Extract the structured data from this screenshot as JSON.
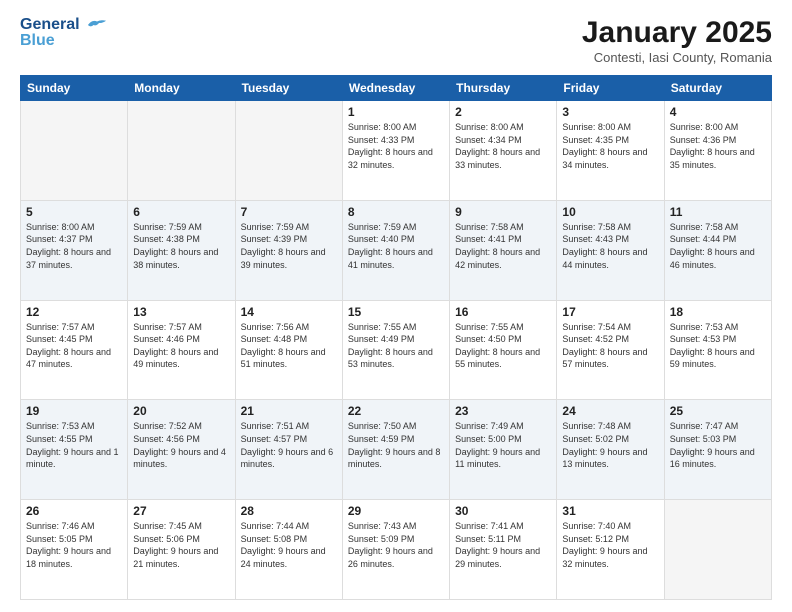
{
  "logo": {
    "line1": "General",
    "line2": "Blue"
  },
  "title": "January 2025",
  "subtitle": "Contesti, Iasi County, Romania",
  "weekdays": [
    "Sunday",
    "Monday",
    "Tuesday",
    "Wednesday",
    "Thursday",
    "Friday",
    "Saturday"
  ],
  "weeks": [
    [
      {
        "day": "",
        "empty": true
      },
      {
        "day": "",
        "empty": true
      },
      {
        "day": "",
        "empty": true
      },
      {
        "day": "1",
        "rise": "8:00 AM",
        "set": "4:33 PM",
        "daylight": "8 hours and 32 minutes."
      },
      {
        "day": "2",
        "rise": "8:00 AM",
        "set": "4:34 PM",
        "daylight": "8 hours and 33 minutes."
      },
      {
        "day": "3",
        "rise": "8:00 AM",
        "set": "4:35 PM",
        "daylight": "8 hours and 34 minutes."
      },
      {
        "day": "4",
        "rise": "8:00 AM",
        "set": "4:36 PM",
        "daylight": "8 hours and 35 minutes."
      }
    ],
    [
      {
        "day": "5",
        "rise": "8:00 AM",
        "set": "4:37 PM",
        "daylight": "8 hours and 37 minutes."
      },
      {
        "day": "6",
        "rise": "7:59 AM",
        "set": "4:38 PM",
        "daylight": "8 hours and 38 minutes."
      },
      {
        "day": "7",
        "rise": "7:59 AM",
        "set": "4:39 PM",
        "daylight": "8 hours and 39 minutes."
      },
      {
        "day": "8",
        "rise": "7:59 AM",
        "set": "4:40 PM",
        "daylight": "8 hours and 41 minutes."
      },
      {
        "day": "9",
        "rise": "7:58 AM",
        "set": "4:41 PM",
        "daylight": "8 hours and 42 minutes."
      },
      {
        "day": "10",
        "rise": "7:58 AM",
        "set": "4:43 PM",
        "daylight": "8 hours and 44 minutes."
      },
      {
        "day": "11",
        "rise": "7:58 AM",
        "set": "4:44 PM",
        "daylight": "8 hours and 46 minutes."
      }
    ],
    [
      {
        "day": "12",
        "rise": "7:57 AM",
        "set": "4:45 PM",
        "daylight": "8 hours and 47 minutes."
      },
      {
        "day": "13",
        "rise": "7:57 AM",
        "set": "4:46 PM",
        "daylight": "8 hours and 49 minutes."
      },
      {
        "day": "14",
        "rise": "7:56 AM",
        "set": "4:48 PM",
        "daylight": "8 hours and 51 minutes."
      },
      {
        "day": "15",
        "rise": "7:55 AM",
        "set": "4:49 PM",
        "daylight": "8 hours and 53 minutes."
      },
      {
        "day": "16",
        "rise": "7:55 AM",
        "set": "4:50 PM",
        "daylight": "8 hours and 55 minutes."
      },
      {
        "day": "17",
        "rise": "7:54 AM",
        "set": "4:52 PM",
        "daylight": "8 hours and 57 minutes."
      },
      {
        "day": "18",
        "rise": "7:53 AM",
        "set": "4:53 PM",
        "daylight": "8 hours and 59 minutes."
      }
    ],
    [
      {
        "day": "19",
        "rise": "7:53 AM",
        "set": "4:55 PM",
        "daylight": "9 hours and 1 minute."
      },
      {
        "day": "20",
        "rise": "7:52 AM",
        "set": "4:56 PM",
        "daylight": "9 hours and 4 minutes."
      },
      {
        "day": "21",
        "rise": "7:51 AM",
        "set": "4:57 PM",
        "daylight": "9 hours and 6 minutes."
      },
      {
        "day": "22",
        "rise": "7:50 AM",
        "set": "4:59 PM",
        "daylight": "9 hours and 8 minutes."
      },
      {
        "day": "23",
        "rise": "7:49 AM",
        "set": "5:00 PM",
        "daylight": "9 hours and 11 minutes."
      },
      {
        "day": "24",
        "rise": "7:48 AM",
        "set": "5:02 PM",
        "daylight": "9 hours and 13 minutes."
      },
      {
        "day": "25",
        "rise": "7:47 AM",
        "set": "5:03 PM",
        "daylight": "9 hours and 16 minutes."
      }
    ],
    [
      {
        "day": "26",
        "rise": "7:46 AM",
        "set": "5:05 PM",
        "daylight": "9 hours and 18 minutes."
      },
      {
        "day": "27",
        "rise": "7:45 AM",
        "set": "5:06 PM",
        "daylight": "9 hours and 21 minutes."
      },
      {
        "day": "28",
        "rise": "7:44 AM",
        "set": "5:08 PM",
        "daylight": "9 hours and 24 minutes."
      },
      {
        "day": "29",
        "rise": "7:43 AM",
        "set": "5:09 PM",
        "daylight": "9 hours and 26 minutes."
      },
      {
        "day": "30",
        "rise": "7:41 AM",
        "set": "5:11 PM",
        "daylight": "9 hours and 29 minutes."
      },
      {
        "day": "31",
        "rise": "7:40 AM",
        "set": "5:12 PM",
        "daylight": "9 hours and 32 minutes."
      },
      {
        "day": "",
        "empty": true
      }
    ]
  ]
}
